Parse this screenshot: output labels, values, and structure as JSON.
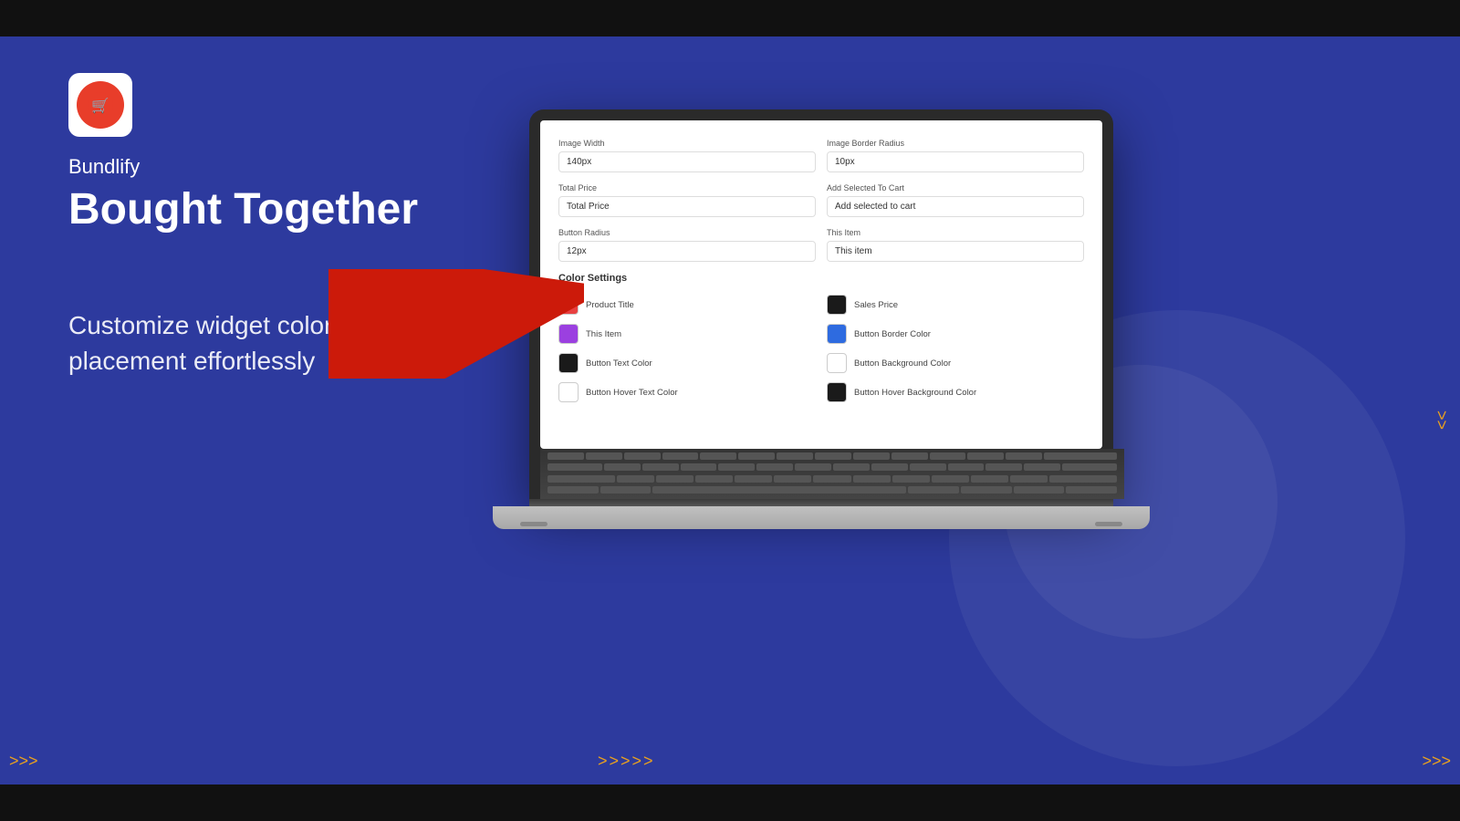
{
  "topbar": {},
  "brand": {
    "name": "Bundlify",
    "title": "Bought Together",
    "tagline": "Customize widget color, size, and placement effortlessly"
  },
  "arrows": {
    "top": ">>>>>",
    "bottom_left": ">>>>>",
    "right": ">>",
    "bottom_right": ">>>",
    "bottom_far_left": ">>>"
  },
  "screen": {
    "fields": {
      "image_width_label": "Image Width",
      "image_width_value": "140px",
      "image_border_radius_label": "Image Border Radius",
      "image_border_radius_value": "10px",
      "total_price_label": "Total Price",
      "total_price_value": "Total Price",
      "add_selected_label": "Add Selected To Cart",
      "add_selected_value": "Add selected to cart",
      "button_radius_label": "Button Radius",
      "button_radius_value": "12px",
      "this_item_label": "This Item",
      "this_item_value": "This item"
    },
    "color_settings_title": "Color Settings",
    "colors": [
      {
        "label": "Product Title",
        "color": "#e84040"
      },
      {
        "label": "Sales Price",
        "color": "#1a1a1a"
      },
      {
        "label": "This Item",
        "color": "#9b40e0"
      },
      {
        "label": "Button Border Color",
        "color": "#2e6be0"
      },
      {
        "label": "Button Text Color",
        "color": "#1a1a1a"
      },
      {
        "label": "Button Background Color",
        "color": "#ffffff"
      },
      {
        "label": "Button Hover Text Color",
        "color": "#ffffff"
      },
      {
        "label": "Button Hover Background Color",
        "color": "#1a1a1a"
      }
    ]
  }
}
